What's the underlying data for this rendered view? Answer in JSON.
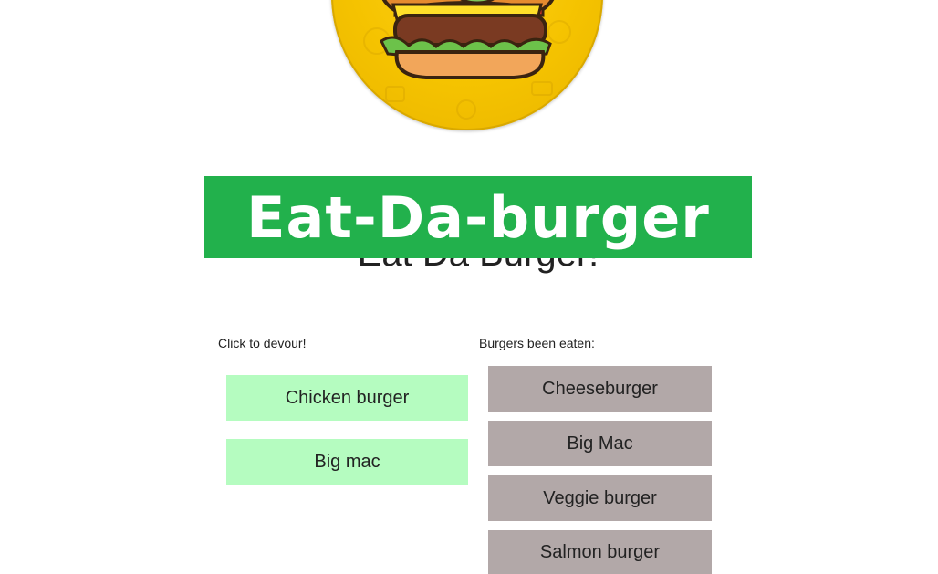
{
  "header": {
    "banner_text": "Eat-Da-burger",
    "heading": "Eat Da Burger!"
  },
  "devour": {
    "label": "Click to devour!",
    "items": [
      {
        "label": "Chicken burger"
      },
      {
        "label": "Big mac"
      }
    ]
  },
  "eaten": {
    "label": "Burgers been eaten:",
    "items": [
      {
        "label": "Cheeseburger"
      },
      {
        "label": "Big Mac"
      },
      {
        "label": "Veggie burger"
      },
      {
        "label": "Salmon burger"
      }
    ]
  },
  "colors": {
    "banner": "#22b14c",
    "uneaten_button": "#b5fcc0",
    "eaten_button": "#b2a8a8",
    "logo": "#f5c300"
  }
}
